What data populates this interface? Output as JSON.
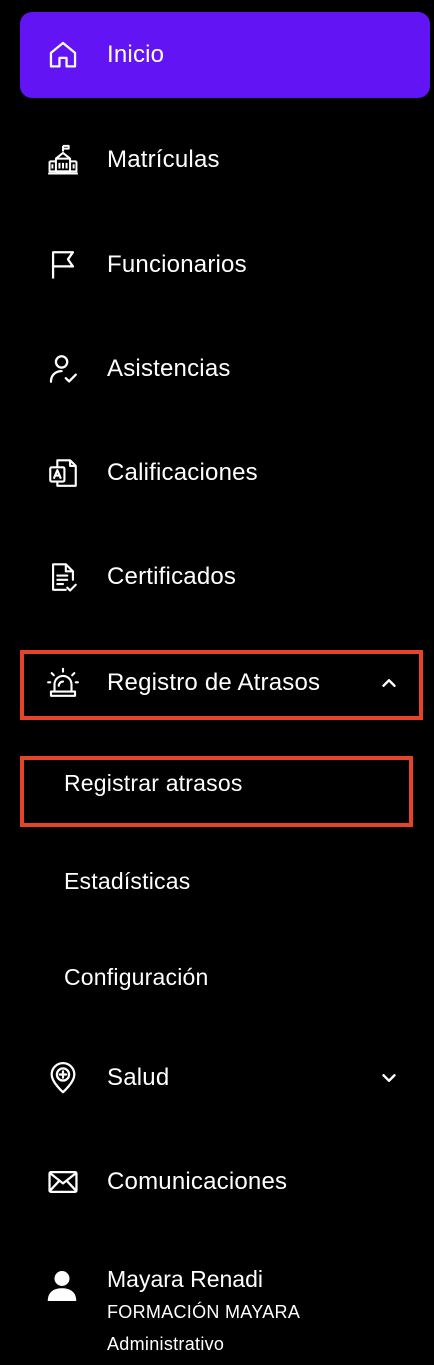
{
  "sidebar": {
    "items": [
      {
        "label": "Inicio",
        "icon": "home-icon"
      },
      {
        "label": "Matrículas",
        "icon": "school-building-icon"
      },
      {
        "label": "Funcionarios",
        "icon": "flag-icon"
      },
      {
        "label": "Asistencias",
        "icon": "user-check-icon"
      },
      {
        "label": "Calificaciones",
        "icon": "grade-document-icon"
      },
      {
        "label": "Certificados",
        "icon": "certificate-document-icon"
      },
      {
        "label": "Registro de Atrasos",
        "icon": "alarm-siren-icon",
        "expanded": true,
        "children": [
          {
            "label": "Registrar atrasos"
          },
          {
            "label": "Estadísticas"
          },
          {
            "label": "Configuración"
          }
        ]
      },
      {
        "label": "Salud",
        "icon": "health-pin-icon",
        "expanded": false
      },
      {
        "label": "Comunicaciones",
        "icon": "mail-icon"
      }
    ]
  },
  "user": {
    "name": "Mayara Renadi",
    "organization": "FORMACIÓN MAYARA",
    "role": "Administrativo",
    "icon": "user-icon"
  },
  "colors": {
    "background": "#000000",
    "active": "#6214f5",
    "highlight": "#e5432a",
    "text": "#ffffff"
  }
}
